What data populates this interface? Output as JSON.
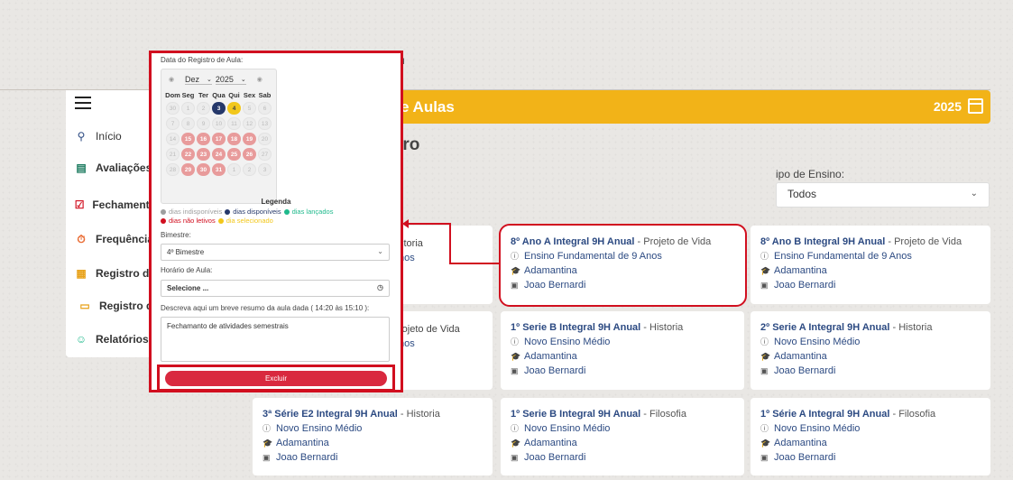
{
  "sidebar": {
    "items": [
      {
        "icon": "map-pin-icon",
        "glyph": "⚲",
        "label": "Início"
      },
      {
        "icon": "clipboard-list-icon",
        "glyph": "▤",
        "label": "Avaliações"
      },
      {
        "icon": "checkbox-icon",
        "glyph": "☑",
        "label": "Fechamento"
      },
      {
        "icon": "timer-icon",
        "glyph": "⏱",
        "label": "Frequência"
      },
      {
        "icon": "calendar-icon",
        "glyph": "▦",
        "label": "Registro de"
      },
      {
        "icon": "folder-icon",
        "glyph": "▭",
        "label": "Registro d"
      },
      {
        "icon": "palette-icon",
        "glyph": "☺",
        "label": "Relatórios"
      }
    ]
  },
  "header": {
    "title": "e Aulas",
    "year": "2025",
    "subtitle": "tro"
  },
  "stray_text": "M",
  "filter": {
    "label": "ipo de Ensino:",
    "value": "Todos"
  },
  "cards": [
    {
      "name": "8º Ano A Integral 9H Anual",
      "subject": "Projeto de Vida",
      "level": "Ensino Fundamental de 9 Anos",
      "city": "Adamantina",
      "teacher": "Joao Bernardi"
    },
    {
      "name": "8º Ano B Integral 9H Anual",
      "subject": "Projeto de Vida",
      "level": "Ensino Fundamental de 9 Anos",
      "city": "Adamantina",
      "teacher": "Joao Bernardi"
    },
    {
      "name": "1º Serie B Integral 9H Anual",
      "subject": "Historia",
      "level": "Novo Ensino Médio",
      "city": "Adamantina",
      "teacher": "Joao Bernardi"
    },
    {
      "name": "2º Serie A Integral 9H Anual",
      "subject": "Historia",
      "level": "Novo Ensino Médio",
      "city": "Adamantina",
      "teacher": "Joao Bernardi"
    },
    {
      "name": "3ª Série E2 Integral 9H Anual",
      "subject": "Historia",
      "level": "Novo Ensino Médio",
      "city": "Adamantina",
      "teacher": "Joao Bernardi"
    },
    {
      "name": "1º Serie B Integral 9H Anual",
      "subject": "Filosofia",
      "level": "Novo Ensino Médio",
      "city": "Adamantina",
      "teacher": "Joao Bernardi"
    },
    {
      "name": "1º Série A Integral 9H Anual",
      "subject": "Filosofia",
      "level": "Novo Ensino Médio",
      "city": "Adamantina",
      "teacher": "Joao Bernardi"
    }
  ],
  "partial_cards": [
    {
      "line1": "storia",
      "line2": "nos"
    },
    {
      "line1": "rojeto de Vida",
      "line2": "nos"
    }
  ],
  "modal": {
    "date_label": "Data do Registro de Aula:",
    "month": "Dez",
    "year": "2025",
    "weekdays": [
      "Dom",
      "Seg",
      "Ter",
      "Qua",
      "Qui",
      "Sex",
      "Sab"
    ],
    "days": [
      {
        "d": "30",
        "s": "unav"
      },
      {
        "d": "1",
        "s": "unav"
      },
      {
        "d": "2",
        "s": "unav"
      },
      {
        "d": "3",
        "s": "av"
      },
      {
        "d": "4",
        "s": "sel"
      },
      {
        "d": "5",
        "s": "unav"
      },
      {
        "d": "6",
        "s": "unav"
      },
      {
        "d": "7",
        "s": "unav"
      },
      {
        "d": "8",
        "s": "unav"
      },
      {
        "d": "9",
        "s": "unav"
      },
      {
        "d": "10",
        "s": "unav"
      },
      {
        "d": "11",
        "s": "unav"
      },
      {
        "d": "12",
        "s": "unav"
      },
      {
        "d": "13",
        "s": "unav"
      },
      {
        "d": "14",
        "s": "unav"
      },
      {
        "d": "15",
        "s": "nl"
      },
      {
        "d": "16",
        "s": "nl"
      },
      {
        "d": "17",
        "s": "nl"
      },
      {
        "d": "18",
        "s": "nl"
      },
      {
        "d": "19",
        "s": "nl"
      },
      {
        "d": "20",
        "s": "unav"
      },
      {
        "d": "21",
        "s": "unav"
      },
      {
        "d": "22",
        "s": "nl"
      },
      {
        "d": "23",
        "s": "nl"
      },
      {
        "d": "24",
        "s": "nl"
      },
      {
        "d": "25",
        "s": "nl"
      },
      {
        "d": "26",
        "s": "nl"
      },
      {
        "d": "27",
        "s": "unav"
      },
      {
        "d": "28",
        "s": "unav"
      },
      {
        "d": "29",
        "s": "nl"
      },
      {
        "d": "30",
        "s": "nl"
      },
      {
        "d": "31",
        "s": "nl"
      },
      {
        "d": "1",
        "s": "unav"
      },
      {
        "d": "2",
        "s": "unav"
      },
      {
        "d": "3",
        "s": "unav"
      }
    ],
    "legend_title": "Legenda",
    "legend": [
      {
        "label": "dias indisponíveis",
        "color": "#9e9e9e"
      },
      {
        "label": "dias disponíveis",
        "color": "#25386a"
      },
      {
        "label": "dias lançados",
        "color": "#1fb98c"
      },
      {
        "label": "dias não letivos",
        "color": "#d10f1f"
      },
      {
        "label": "dia selecionado",
        "color": "#f2c71b"
      }
    ],
    "bimestre_label": "Bimestre:",
    "bimestre_value": "4º Bimestre",
    "horario_label": "Horário de Aula:",
    "horario_value": "Selecione ...",
    "resumo_label": "Descreva aqui um breve resumo da aula dada ( 14:20 às 15:10 ):",
    "resumo_value": "Fechamanto de atividades semestrais",
    "delete_label": "Excluir"
  },
  "colors": {
    "accent": "#f2b318",
    "highlight": "#d10f1f",
    "navy": "#2c4a82",
    "delete": "#d9293f"
  }
}
